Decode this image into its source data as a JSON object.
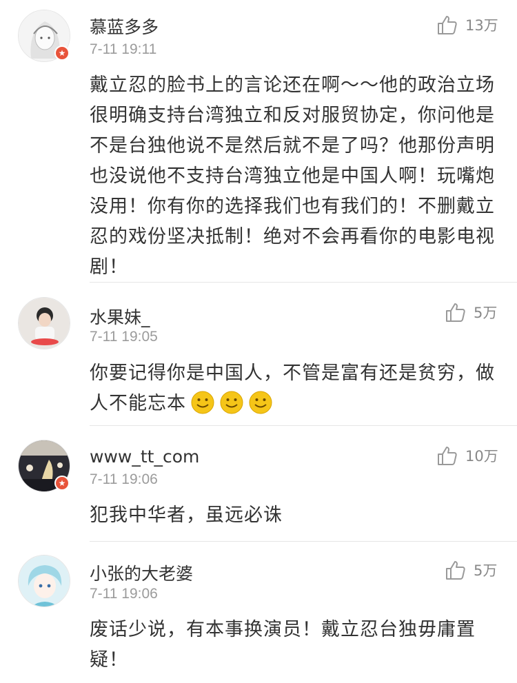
{
  "comments": [
    {
      "username": "慕蓝多多",
      "time": "7-11 19:11",
      "likes": "13万",
      "verified": true,
      "avatar": "avatar-girl-sketch",
      "text": "戴立忍的脸书上的言论还在啊～～他的政治立场很明确支持台湾独立和反对服贸协定，你问他是不是台独他说不是然后就不是了吗？他那份声明也没说他不支持台湾独立他是中国人啊！玩嘴炮没用！你有你的选择我们也有我们的！不删戴立忍的戏份坚决抵制！绝对不会再看你的电影电视剧！"
    },
    {
      "username": "水果妹_",
      "time": "7-11 19:05",
      "likes": "5万",
      "verified": false,
      "avatar": "avatar-child-photo",
      "text": "你要记得你是中国人，不管是富有还是贫穷，做人不能忘本",
      "emojis": [
        "smile-emoji",
        "smile-emoji",
        "smile-emoji"
      ]
    },
    {
      "username": "www_tt_com",
      "time": "7-11 19:06",
      "likes": "10万",
      "verified": true,
      "avatar": "avatar-concert-photo",
      "text": "犯我中华者，虽远必诛"
    },
    {
      "username": "小张的大老婆",
      "time": "7-11 19:06",
      "likes": "5万",
      "verified": false,
      "avatar": "avatar-anime-boy",
      "text": "废话少说，有本事换演员！戴立忍台独毋庸置疑！"
    }
  ],
  "colors": {
    "badge": "#e8533a",
    "emoji": "#f5c518"
  },
  "icons": {
    "like": "thumbs-up-icon",
    "verified": "verified-badge-icon"
  }
}
